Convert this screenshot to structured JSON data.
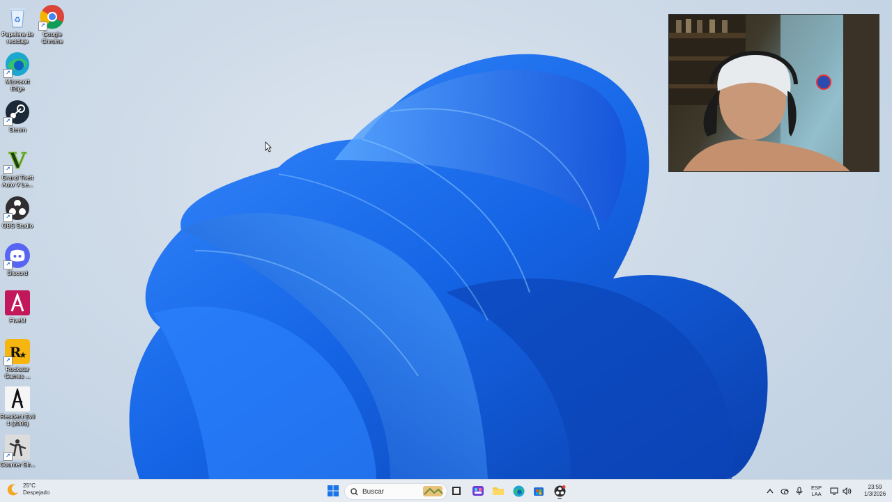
{
  "desktop_icons": [
    {
      "label": "Papelera de reciclaje",
      "icon": "recycle-bin-icon"
    },
    {
      "label": "Google Chrome",
      "icon": "chrome-icon"
    },
    {
      "label": "Microsoft Edge",
      "icon": "edge-icon"
    },
    {
      "label": "Steam",
      "icon": "steam-icon"
    },
    {
      "label": "Grand Theft Auto V Le...",
      "icon": "gta-v-icon"
    },
    {
      "label": "OBS Studio",
      "icon": "obs-icon"
    },
    {
      "label": "Discord",
      "icon": "discord-icon"
    },
    {
      "label": "FiveM",
      "icon": "fivem-icon"
    },
    {
      "label": "Rockstar Games ...",
      "icon": "rockstar-icon"
    },
    {
      "label": "Resident Evil 4 (2005)",
      "icon": "resident-evil-icon"
    },
    {
      "label": "Counter Str...",
      "icon": "counter-strike-icon"
    }
  ],
  "taskbar": {
    "weather_temp": "25°C",
    "weather_desc": "Despejado",
    "search_placeholder": "Buscar",
    "lang_line1": "ESP",
    "lang_line2": "LAA",
    "time": "23:59",
    "date": "1/3/2026"
  },
  "colors": {
    "taskbar_bg": "#e7ecf3",
    "bloom_blue": "#1f6fe8"
  }
}
